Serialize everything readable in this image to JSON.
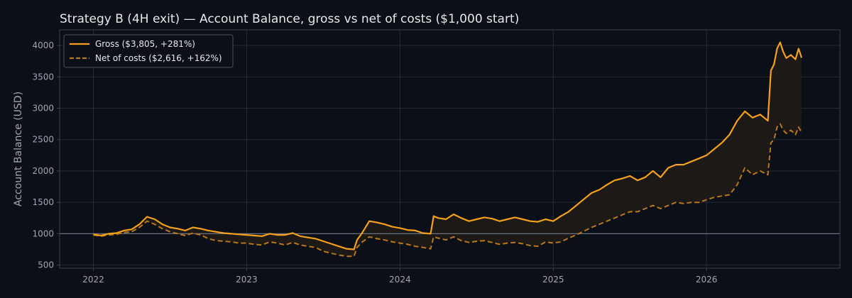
{
  "chart_data": {
    "type": "line",
    "title": "Strategy B (4H exit) — Account Balance, gross vs net of costs ($1,000 start)",
    "xlabel": "",
    "ylabel": "Account Balance (USD)",
    "xlim": [
      2021.78,
      2026.87
    ],
    "ylim": [
      450,
      4250
    ],
    "xticks": [
      2022,
      2023,
      2024,
      2025,
      2026
    ],
    "xtick_labels": [
      "2022",
      "2023",
      "2024",
      "2025",
      "2026"
    ],
    "yticks": [
      500,
      1000,
      1500,
      2000,
      2500,
      3000,
      3500,
      4000
    ],
    "ytick_labels": [
      "500",
      "1000",
      "1500",
      "2000",
      "2500",
      "3000",
      "3500",
      "4000"
    ],
    "baseline": 1000,
    "grid": true,
    "legend_position": "top-left",
    "colors": {
      "background": "#0b0f17",
      "grid": "#262b36",
      "axis": "#3a404c",
      "text": "#e8e8e8",
      "tick_text": "#a0a6b2",
      "gross": "#f5a01a",
      "net": "#b8781a",
      "fill": "#1e1a17",
      "baseline": "#6b7080"
    },
    "series": [
      {
        "name": "Gross ($3,805, +281%)",
        "style": "solid",
        "x": [
          2022.0,
          2022.05,
          2022.1,
          2022.15,
          2022.2,
          2022.25,
          2022.3,
          2022.35,
          2022.4,
          2022.45,
          2022.5,
          2022.55,
          2022.6,
          2022.65,
          2022.7,
          2022.75,
          2022.8,
          2022.85,
          2022.9,
          2022.95,
          2023.0,
          2023.05,
          2023.1,
          2023.15,
          2023.2,
          2023.25,
          2023.3,
          2023.35,
          2023.4,
          2023.45,
          2023.5,
          2023.55,
          2023.6,
          2023.65,
          2023.7,
          2023.72,
          2023.75,
          2023.8,
          2023.85,
          2023.9,
          2023.95,
          2024.0,
          2024.05,
          2024.1,
          2024.15,
          2024.2,
          2024.22,
          2024.25,
          2024.3,
          2024.35,
          2024.4,
          2024.45,
          2024.5,
          2024.55,
          2024.6,
          2024.65,
          2024.7,
          2024.75,
          2024.8,
          2024.85,
          2024.9,
          2024.95,
          2025.0,
          2025.05,
          2025.1,
          2025.15,
          2025.2,
          2025.25,
          2025.3,
          2025.35,
          2025.4,
          2025.45,
          2025.5,
          2025.55,
          2025.6,
          2025.65,
          2025.7,
          2025.75,
          2025.8,
          2025.85,
          2025.9,
          2025.95,
          2026.0,
          2026.05,
          2026.1,
          2026.15,
          2026.2,
          2026.25,
          2026.3,
          2026.35,
          2026.4,
          2026.42,
          2026.44,
          2026.46,
          2026.48,
          2026.5,
          2026.52,
          2026.55,
          2026.58,
          2026.6,
          2026.62
        ],
        "values": [
          990,
          970,
          1000,
          1010,
          1050,
          1070,
          1150,
          1270,
          1230,
          1150,
          1100,
          1080,
          1050,
          1100,
          1080,
          1050,
          1030,
          1010,
          1000,
          990,
          980,
          970,
          960,
          1000,
          980,
          980,
          1010,
          960,
          940,
          920,
          880,
          840,
          800,
          760,
          750,
          900,
          1000,
          1200,
          1180,
          1150,
          1110,
          1090,
          1060,
          1050,
          1010,
          1000,
          1280,
          1250,
          1230,
          1310,
          1250,
          1200,
          1230,
          1260,
          1240,
          1200,
          1230,
          1260,
          1230,
          1200,
          1190,
          1230,
          1200,
          1280,
          1350,
          1450,
          1550,
          1650,
          1700,
          1780,
          1850,
          1880,
          1920,
          1850,
          1900,
          2000,
          1900,
          2050,
          2100,
          2100,
          2150,
          2200,
          2250,
          2350,
          2450,
          2580,
          2800,
          2950,
          2850,
          2900,
          2800,
          3600,
          3700,
          3950,
          4050,
          3900,
          3800,
          3850,
          3780,
          3950,
          3805
        ]
      },
      {
        "name": "Net of costs ($2,616, +162%)",
        "style": "dashed",
        "x": [
          2022.0,
          2022.05,
          2022.1,
          2022.15,
          2022.2,
          2022.25,
          2022.3,
          2022.35,
          2022.4,
          2022.45,
          2022.5,
          2022.55,
          2022.6,
          2022.65,
          2022.7,
          2022.75,
          2022.8,
          2022.85,
          2022.9,
          2022.95,
          2023.0,
          2023.05,
          2023.1,
          2023.15,
          2023.2,
          2023.25,
          2023.3,
          2023.35,
          2023.4,
          2023.45,
          2023.5,
          2023.55,
          2023.6,
          2023.65,
          2023.7,
          2023.72,
          2023.75,
          2023.8,
          2023.85,
          2023.9,
          2023.95,
          2024.0,
          2024.05,
          2024.1,
          2024.15,
          2024.2,
          2024.22,
          2024.25,
          2024.3,
          2024.35,
          2024.4,
          2024.45,
          2024.5,
          2024.55,
          2024.6,
          2024.65,
          2024.7,
          2024.75,
          2024.8,
          2024.85,
          2024.9,
          2024.95,
          2025.0,
          2025.05,
          2025.1,
          2025.15,
          2025.2,
          2025.25,
          2025.3,
          2025.35,
          2025.4,
          2025.45,
          2025.5,
          2025.55,
          2025.6,
          2025.65,
          2025.7,
          2025.75,
          2025.8,
          2025.85,
          2025.9,
          2025.95,
          2026.0,
          2026.05,
          2026.1,
          2026.15,
          2026.2,
          2026.25,
          2026.3,
          2026.35,
          2026.4,
          2026.42,
          2026.44,
          2026.46,
          2026.48,
          2026.5,
          2026.52,
          2026.55,
          2026.58,
          2026.6,
          2026.62
        ],
        "values": [
          980,
          960,
          980,
          990,
          1020,
          1030,
          1100,
          1200,
          1150,
          1080,
          1030,
          1000,
          970,
          1010,
          980,
          920,
          890,
          880,
          870,
          850,
          850,
          830,
          820,
          870,
          850,
          820,
          860,
          820,
          800,
          780,
          720,
          690,
          660,
          640,
          640,
          780,
          860,
          950,
          920,
          900,
          870,
          850,
          830,
          800,
          780,
          760,
          950,
          930,
          900,
          950,
          890,
          860,
          880,
          890,
          860,
          830,
          850,
          860,
          840,
          810,
          800,
          870,
          850,
          870,
          930,
          980,
          1040,
          1100,
          1150,
          1200,
          1250,
          1300,
          1350,
          1350,
          1400,
          1450,
          1400,
          1450,
          1500,
          1480,
          1500,
          1500,
          1540,
          1580,
          1600,
          1620,
          1780,
          2050,
          1940,
          2000,
          1940,
          2450,
          2500,
          2700,
          2750,
          2650,
          2600,
          2650,
          2580,
          2700,
          2616
        ]
      }
    ]
  }
}
